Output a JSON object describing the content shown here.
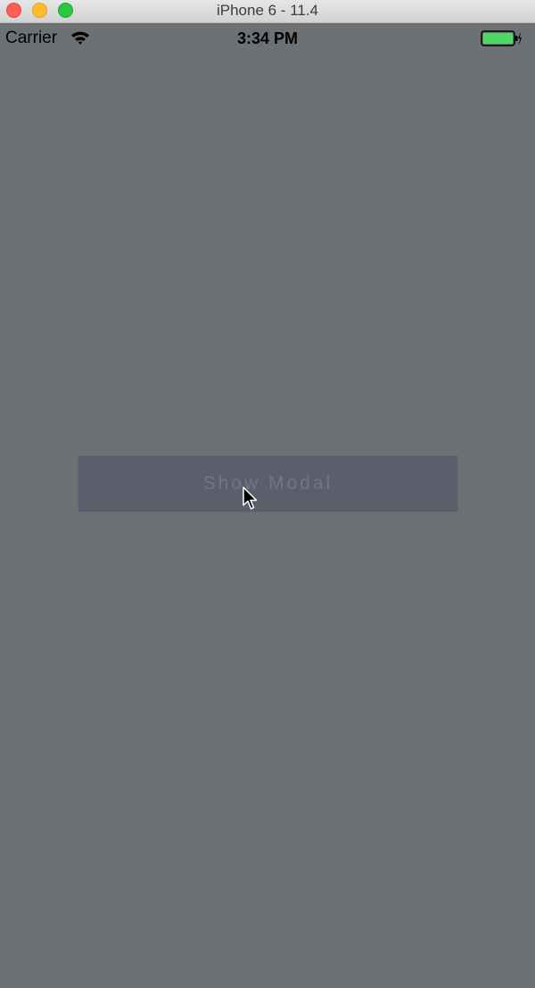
{
  "window": {
    "title": "iPhone 6 - 11.4"
  },
  "statusbar": {
    "carrier": "Carrier",
    "time": "3:34 PM",
    "wifi_icon": "wifi-icon",
    "battery_icon": "battery-charging-icon"
  },
  "main": {
    "button_label": "Show Modal"
  },
  "colors": {
    "background": "#6e7174",
    "button_bg": "#5b5f6c",
    "button_text": "#727684",
    "battery_fill": "#4cd964"
  }
}
